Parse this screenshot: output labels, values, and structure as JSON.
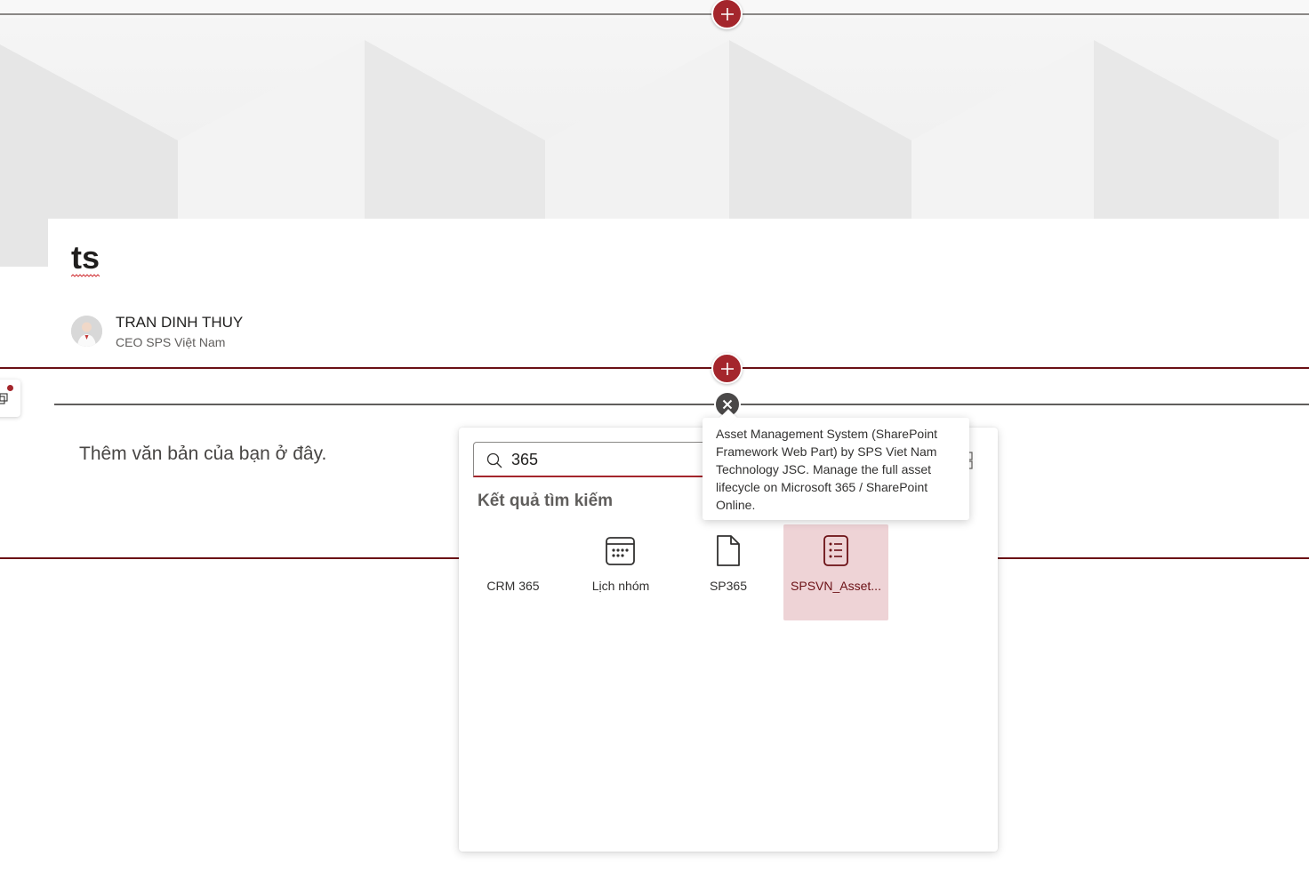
{
  "page": {
    "title": "ts",
    "author_name": "TRAN DINH THUY",
    "author_role": "CEO SPS Việt Nam",
    "text_placeholder": "Thêm văn bản của bạn ở đây."
  },
  "toolbox": {
    "search_value": "365",
    "results_heading": "Kết quả tìm kiếm",
    "results": [
      {
        "label": "CRM 365",
        "icon": "none"
      },
      {
        "label": "Lịch nhóm",
        "icon": "calendar-icon"
      },
      {
        "label": "SP365",
        "icon": "document-icon"
      },
      {
        "label": "SPSVN_Asset...",
        "icon": "list-icon",
        "selected": true
      }
    ],
    "tooltip": "Asset Management System (SharePoint Framework Web Part) by SPS Viet Nam Technology JSC. Manage the full asset lifecycle on Microsoft 365 / SharePoint Online."
  },
  "icons": {
    "add": "plus-icon",
    "close": "close-icon",
    "search": "search-icon",
    "grid": "grid-view-icon"
  },
  "colors": {
    "accent": "#a4262c",
    "section_border": "#6b1015",
    "selected_tile": "#eed3d6",
    "close_button": "#4a4848"
  }
}
